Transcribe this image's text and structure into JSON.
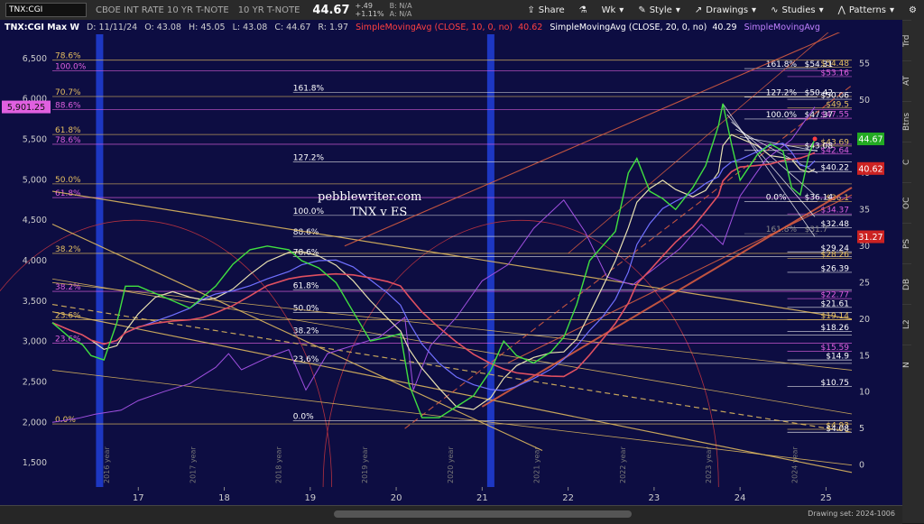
{
  "toolbar": {
    "symbol": "TNX:CGI",
    "description": "CBOE INT RATE 10 YR T-NOTE",
    "short_desc": "10 YR T-NOTE",
    "price": "44.67",
    "change": "+.49",
    "change_pct": "+1.11%",
    "bid": "B: N/A",
    "ask": "A: N/A",
    "share": "Share",
    "wk": "Wk",
    "style": "Style",
    "drawings": "Drawings",
    "studies": "Studies",
    "patterns": "Patterns"
  },
  "side_tabs": [
    "Trd",
    "AT",
    "Btns",
    "C",
    "OC",
    "PS",
    "DB",
    "L2",
    "N"
  ],
  "bottom": {
    "drawing_set": "Drawing set: 2024-1006"
  },
  "chart_data": {
    "type": "line",
    "info": {
      "symbol": "TNX:CGI Max W",
      "date": "D: 11/11/24",
      "open": "O: 43.08",
      "high": "H: 45.05",
      "low": "L: 43.08",
      "close": "C: 44.67",
      "range": "R: 1.97",
      "sma10": "SimpleMovingAvg (CLOSE, 10, 0, no)",
      "sma10_val": "40.62",
      "sma20": "SimpleMovingAvg (CLOSE, 20, 0, no)",
      "sma20_val": "40.29",
      "sma_other": "SimpleMovingAvg"
    },
    "annotation": [
      "pebblewriter.com",
      "TNX v ES"
    ],
    "x_ticks": [
      "17",
      "18",
      "19",
      "20",
      "21",
      "22",
      "23",
      "24",
      "25"
    ],
    "x_range": [
      2016.0,
      2025.3
    ],
    "cycle_labels": [
      "2016 year",
      "2017 year",
      "2018 year",
      "2019 year",
      "2020 year",
      "2021 year",
      "2022 year",
      "2023 year",
      "2024 year"
    ],
    "left_axis": {
      "ticks": [
        "6,500",
        "6,000",
        "5,500",
        "5,000",
        "4,500",
        "4,000",
        "3,500",
        "3,000",
        "2,500",
        "2,000",
        "1,500"
      ],
      "range": [
        1200,
        6800
      ],
      "highlight": "5,901.25"
    },
    "right_axis": {
      "ticks": [
        "55",
        "50",
        "45",
        "40",
        "35",
        "30",
        "25",
        "20",
        "15",
        "10",
        "5",
        "0"
      ],
      "range": [
        -3,
        59
      ]
    },
    "right_badges": [
      {
        "value": "44.67",
        "color": "#22aa22"
      },
      {
        "value": "40.62",
        "color": "#cc2222"
      },
      {
        "value": "31.27",
        "color": "#cc2222"
      }
    ],
    "left_fib_levels": [
      {
        "label": "78.6%",
        "y": 6480,
        "color": "#e8c060"
      },
      {
        "label": "100.0%",
        "y": 6350,
        "color": "#e060e0"
      },
      {
        "label": "70.7%",
        "y": 6030,
        "color": "#e8c060"
      },
      {
        "label": "88.6%",
        "y": 5870,
        "color": "#e060e0"
      },
      {
        "label": "61.8%",
        "y": 5560,
        "color": "#e8c060"
      },
      {
        "label": "78.6%",
        "y": 5440,
        "color": "#e060e0"
      },
      {
        "label": "50.0%",
        "y": 4950,
        "color": "#e8c060"
      },
      {
        "label": "61.8%",
        "y": 4780,
        "color": "#e060e0"
      },
      {
        "label": "38.2%",
        "y": 4090,
        "color": "#e8c060"
      },
      {
        "label": "38.2%",
        "y": 3620,
        "color": "#e060e0"
      },
      {
        "label": "23.6%",
        "y": 3270,
        "color": "#e8c060"
      },
      {
        "label": "23.6%",
        "y": 2980,
        "color": "#e060e0"
      },
      {
        "label": "0.0%",
        "y": 1980,
        "color": "#e8c060"
      }
    ],
    "mid_fib_levels": [
      {
        "label": "161.8%",
        "y": 6080
      },
      {
        "label": "127.2%",
        "y": 5220
      },
      {
        "label": "100.0%",
        "y": 4560
      },
      {
        "label": "88.6%",
        "y": 4300
      },
      {
        "label": "78.6%",
        "y": 4050
      },
      {
        "label": "61.8%",
        "y": 3640
      },
      {
        "label": "50.0%",
        "y": 3360
      },
      {
        "label": "38.2%",
        "y": 3080
      },
      {
        "label": "23.6%",
        "y": 2730
      },
      {
        "label": "0.0%",
        "y": 2020
      }
    ],
    "right_fib_levels": [
      {
        "label": "161.8%",
        "value": "$54.31",
        "y": 54.3,
        "color": "#ffffff"
      },
      {
        "label": "127.2%",
        "value": "$50.42",
        "y": 50.4,
        "color": "#ffffff"
      },
      {
        "label": "100.0%",
        "value": "$47.37",
        "y": 47.4,
        "color": "#ffffff"
      },
      {
        "label": "",
        "value": "$43.08",
        "y": 43.1,
        "color": "#ffffff"
      },
      {
        "label": "0.0%",
        "value": "$36.14",
        "y": 36.1,
        "color": "#ffffff"
      },
      {
        "label": "161.8%",
        "value": "$31.7",
        "y": 31.7,
        "color": "#888888"
      }
    ],
    "right_price_labels": [
      {
        "value": "$54.48",
        "y": 54.5,
        "color": "#e8c060"
      },
      {
        "value": "$53.16",
        "y": 53.2,
        "color": "#e060e0"
      },
      {
        "value": "$50.06",
        "y": 50.1,
        "color": "#ffffff"
      },
      {
        "value": "$49.5",
        "y": 48.9,
        "color": "#e8c060"
      },
      {
        "value": "$47.55",
        "y": 47.5,
        "color": "#e060e0"
      },
      {
        "value": "$43.69",
        "y": 43.7,
        "color": "#e8c060"
      },
      {
        "value": "$42.64",
        "y": 42.6,
        "color": "#e060e0"
      },
      {
        "value": "$40.22",
        "y": 40.2,
        "color": "#ffffff"
      },
      {
        "value": "$36.1",
        "y": 36.1,
        "color": "#e8c060"
      },
      {
        "value": "$34.37",
        "y": 34.4,
        "color": "#e060e0"
      },
      {
        "value": "$32.48",
        "y": 32.5,
        "color": "#ffffff"
      },
      {
        "value": "$29.24",
        "y": 29.2,
        "color": "#ffffff"
      },
      {
        "value": "$28.26",
        "y": 28.3,
        "color": "#e8c060"
      },
      {
        "value": "$26.39",
        "y": 26.4,
        "color": "#ffffff"
      },
      {
        "value": "$22.77",
        "y": 22.8,
        "color": "#e060e0"
      },
      {
        "value": "$21.61",
        "y": 21.6,
        "color": "#ffffff"
      },
      {
        "value": "$19.14",
        "y": 19.9,
        "color": "#e8c060"
      },
      {
        "value": "$18.26",
        "y": 18.3,
        "color": "#ffffff"
      },
      {
        "value": "$15.59",
        "y": 15.6,
        "color": "#e060e0"
      },
      {
        "value": "$14.9",
        "y": 14.4,
        "color": "#ffffff"
      },
      {
        "value": "$10.75",
        "y": 10.75,
        "color": "#ffffff"
      },
      {
        "value": "$4.93",
        "y": 4.9,
        "color": "#e8c060"
      },
      {
        "value": "$4.08",
        "y": 4.5,
        "color": "#ffffff"
      }
    ],
    "tnx_series": {
      "x": [
        2016.0,
        2016.2,
        2016.35,
        2016.45,
        2016.6,
        2016.75,
        2016.85,
        2017.0,
        2017.2,
        2017.4,
        2017.6,
        2017.75,
        2017.9,
        2018.1,
        2018.3,
        2018.5,
        2018.75,
        2018.9,
        2019.1,
        2019.3,
        2019.5,
        2019.7,
        2019.9,
        2020.05,
        2020.15,
        2020.3,
        2020.5,
        2020.7,
        2020.9,
        2021.1,
        2021.25,
        2021.4,
        2021.6,
        2021.8,
        2021.95,
        2022.1,
        2022.25,
        2022.4,
        2022.55,
        2022.7,
        2022.8,
        2022.95,
        2023.1,
        2023.25,
        2023.45,
        2023.6,
        2023.75,
        2023.8,
        2023.9,
        2024.0,
        2024.2,
        2024.35,
        2024.5,
        2024.6,
        2024.7,
        2024.8,
        2024.87
      ],
      "y": [
        19.5,
        17.5,
        16.5,
        15.0,
        14.4,
        19.5,
        24.5,
        24.5,
        23.5,
        22.5,
        21.5,
        23.0,
        24.5,
        27.5,
        29.5,
        30.0,
        29.5,
        28.0,
        27.0,
        25.0,
        21.0,
        17.0,
        17.5,
        18.0,
        11.0,
        6.5,
        6.5,
        8.0,
        9.5,
        13.0,
        17.0,
        15.0,
        14.0,
        15.5,
        17.5,
        22.0,
        28.0,
        30.0,
        32.0,
        40.0,
        42.0,
        37.5,
        36.5,
        35.0,
        38.0,
        41.0,
        46.5,
        49.5,
        44.0,
        39.0,
        42.5,
        44.0,
        43.0,
        38.0,
        37.0,
        42.5,
        44.67
      ]
    },
    "es_series": {
      "x": [
        2016.0,
        2016.3,
        2016.5,
        2016.8,
        2017.0,
        2017.3,
        2017.6,
        2017.9,
        2018.05,
        2018.2,
        2018.5,
        2018.75,
        2018.95,
        2019.2,
        2019.5,
        2019.8,
        2020.1,
        2020.2,
        2020.4,
        2020.7,
        2021.0,
        2021.3,
        2021.6,
        2021.95,
        2022.2,
        2022.45,
        2022.75,
        2023.0,
        2023.3,
        2023.55,
        2023.8,
        2024.0,
        2024.3,
        2024.6,
        2024.87
      ],
      "y": [
        2000,
        2050,
        2100,
        2150,
        2270,
        2380,
        2480,
        2680,
        2850,
        2650,
        2800,
        2900,
        2400,
        2850,
        2950,
        3050,
        3300,
        2400,
        2950,
        3300,
        3750,
        3950,
        4400,
        4750,
        4350,
        3800,
        3700,
        3900,
        4150,
        4450,
        4200,
        4800,
        5250,
        5500,
        5901
      ]
    }
  }
}
